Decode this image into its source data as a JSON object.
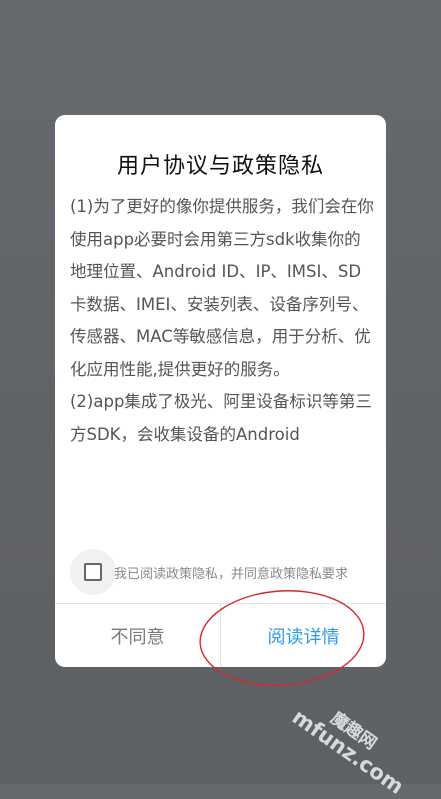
{
  "dialog": {
    "title": "用户协议与政策隐私",
    "paragraphs": [
      "(1)为了更好的像你提供服务，我们会在你使用app必要时会用第三方sdk收集你的地理位置、Android ID、IP、IMSI、SD卡数据、IMEI、安装列表、设备序列号、传感器、MAC等敏感信息，用于分析、优化应用性能,提供更好的服务。",
      "(2)app集成了极光、阿里设备标识等第三方SDK，会收集设备的Android"
    ],
    "agree_checkbox": {
      "label": "我已阅读政策隐私，并同意政策隐私要求",
      "checked": false
    },
    "buttons": {
      "disagree": "不同意",
      "read_details": "阅读详情"
    }
  },
  "watermark": {
    "cn": "魔趣网",
    "en": "mfunz.com"
  },
  "colors": {
    "accent": "#2f9be9",
    "annotation": "#d42a2a"
  }
}
